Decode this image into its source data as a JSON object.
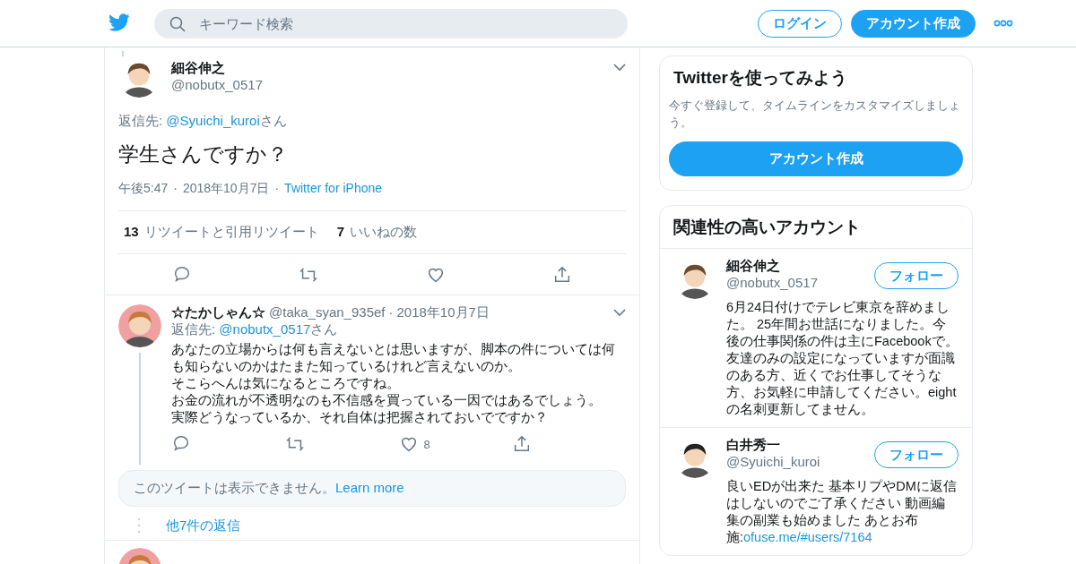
{
  "header": {
    "search": {
      "placeholder": "キーワード検索"
    },
    "buttons": [
      {
        "label": "ログイン",
        "kind": "outline"
      },
      {
        "label": "アカウント作成",
        "kind": "filled"
      }
    ]
  },
  "main_tweet": {
    "name": "細谷伸之",
    "handle": "@nobutx_0517",
    "reply_to": {
      "prefix": "返信先: ",
      "mention": "@Syuichi_kuroi",
      "suffix": "さん"
    },
    "text": "学生さんですか？",
    "time": "午後5:47",
    "separators": [
      "·",
      "·"
    ],
    "date": "2018年10月7日",
    "source": "Twitter for iPhone",
    "stats": [
      {
        "count": "13",
        "label": "リツイートと引用リツイート"
      },
      {
        "count": "7",
        "label": "いいねの数"
      }
    ]
  },
  "replies": [
    {
      "name": "☆たかしゃん☆",
      "handle": "@taka_syan_935ef",
      "date": "2018年10月7日",
      "reply_to": {
        "prefix": "返信先: ",
        "mention": "@nobutx_0517",
        "suffix": "さん"
      },
      "separator": "·",
      "lines": [
        "あなたの立場からは何も言えないとは思いますが、脚本の件については何も知らないのかはたまた知っているけれど言えないのか。",
        "そこらへんは気になるところですね。",
        "お金の流れが不透明なのも不信感を買っている一因ではあるでしょう。",
        "実際どうなっているか、それ自体は把握されておいでですか？"
      ],
      "like_count": "8"
    }
  ],
  "unavailable_notice": {
    "text": "このツイートは表示できません。",
    "link": "Learn more"
  },
  "more_replies": "他7件の返信",
  "sidebar": {
    "signup_card": {
      "title": "Twitterを使ってみよう",
      "subtitle": "今すぐ登録して、タイムラインをカスタマイズしましょう。",
      "button": "アカウント作成"
    },
    "related_accounts": {
      "title": "関連性の高いアカウント",
      "accounts": [
        {
          "name": "細谷伸之",
          "handle": "@nobutx_0517",
          "button": "フォロー",
          "bio": "6月24日付けでテレビ東京を辞めました。 25年間お世話になりました。今後の仕事関係の件は主にFacebookで。友達のみの設定になっていますが面識のある方、近くでお仕事してそうな方、お気軽に申請してください。eightの名刺更新してません。"
        },
        {
          "name": "白井秀一",
          "handle": "@Syuichi_kuroi",
          "button": "フォロー",
          "bio": "良いEDが出来た 基本リプやDMに返信はしないのでご了承ください 動画編集の副業も始めました あとお布施:",
          "bio_link": "ofuse.me/#users/7164"
        }
      ]
    }
  }
}
